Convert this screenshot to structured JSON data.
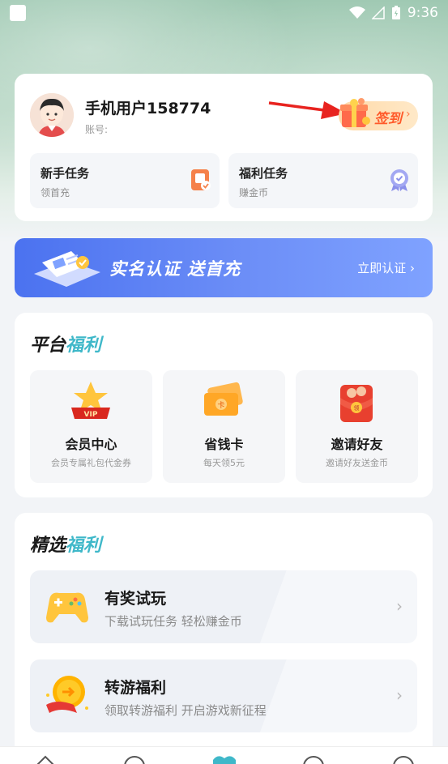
{
  "status_bar": {
    "time": "9:36",
    "icons": [
      "wifi-icon",
      "signal-icon",
      "battery-icon"
    ]
  },
  "user": {
    "name": "手机用户158774",
    "account_label": "账号:",
    "signin_label": "签到",
    "signin_chevron": "›"
  },
  "tasks": [
    {
      "title": "新手任务",
      "subtitle": "领首充",
      "icon": "phone-task-icon"
    },
    {
      "title": "福利任务",
      "subtitle": "赚金币",
      "icon": "medal-icon"
    }
  ],
  "banner": {
    "title": "实名认证  送首充",
    "action": "立即认证 ›"
  },
  "platform": {
    "title_main": "平台",
    "title_accent": "福利",
    "items": [
      {
        "title": "会员中心",
        "subtitle": "会员专属礼包代金券",
        "icon": "vip-crown-icon"
      },
      {
        "title": "省钱卡",
        "subtitle": "每天领5元",
        "icon": "ticket-card-icon"
      },
      {
        "title": "邀请好友",
        "subtitle": "邀请好友送金币",
        "icon": "red-envelope-icon"
      }
    ]
  },
  "selected": {
    "title_main": "精选",
    "title_accent": "福利",
    "items": [
      {
        "title": "有奖试玩",
        "subtitle": "下载试玩任务 轻松赚金币",
        "icon": "gamepad-icon",
        "chevron": "›"
      },
      {
        "title": "转游福利",
        "subtitle": "领取转游福利 开启游戏新征程",
        "icon": "coin-transfer-icon",
        "chevron": "›"
      }
    ]
  },
  "colors": {
    "accent_teal": "#3fb8c9",
    "banner_blue": "#4b72f0",
    "signin_orange": "#ff5a2a"
  }
}
